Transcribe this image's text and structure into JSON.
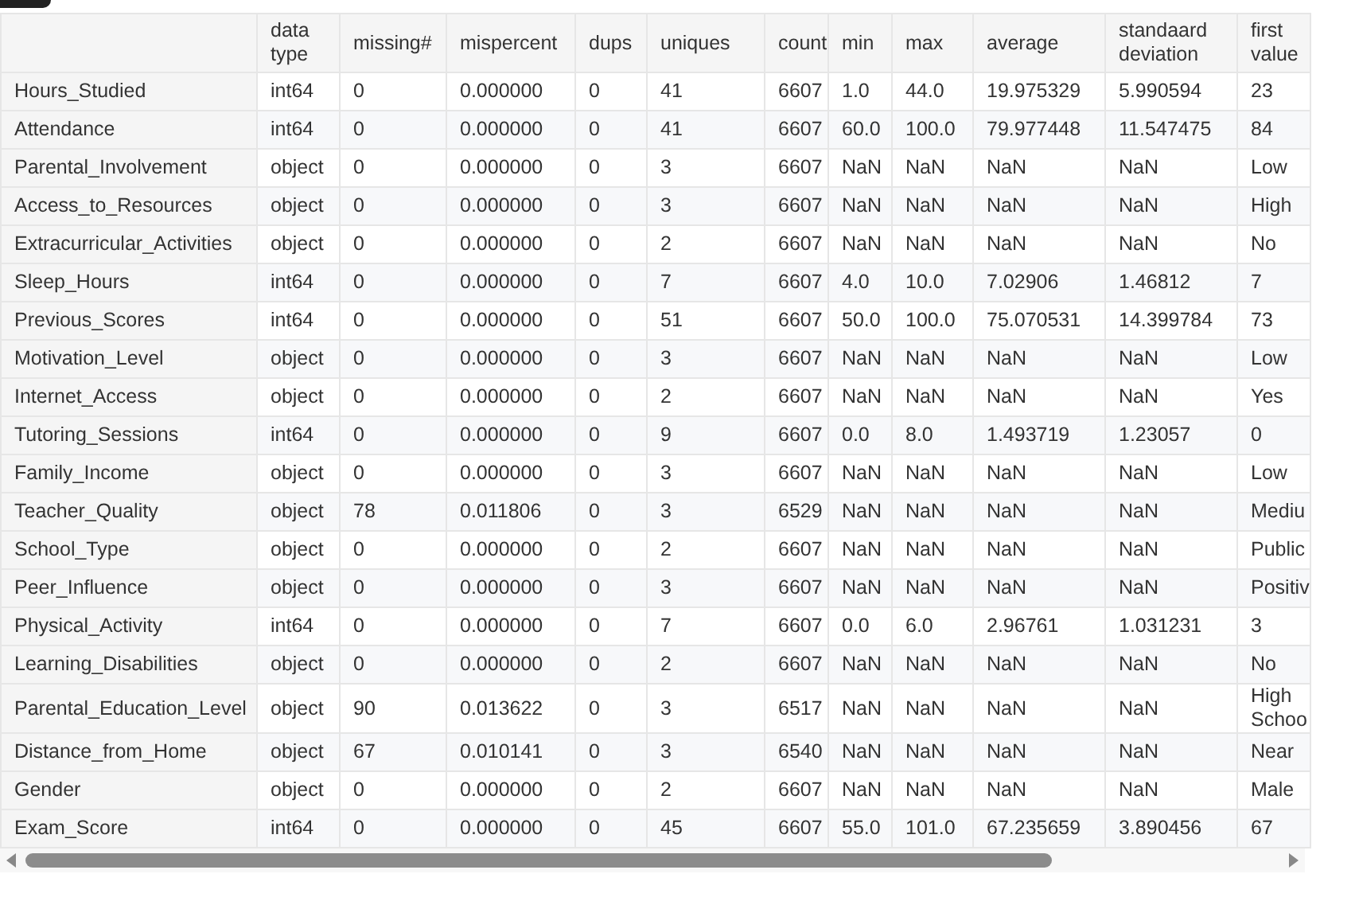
{
  "table": {
    "columns": [
      "data type",
      "missing#",
      "mispercent",
      "dups",
      "uniques",
      "count",
      "min",
      "max",
      "average",
      "standaard deviation",
      "first value"
    ],
    "rows": [
      {
        "name": "Hours_Studied",
        "cells": [
          "int64",
          "0",
          "0.000000",
          "0",
          "41",
          "6607",
          "1.0",
          "44.0",
          "19.975329",
          "5.990594",
          "23"
        ]
      },
      {
        "name": "Attendance",
        "cells": [
          "int64",
          "0",
          "0.000000",
          "0",
          "41",
          "6607",
          "60.0",
          "100.0",
          "79.977448",
          "11.547475",
          "84"
        ]
      },
      {
        "name": "Parental_Involvement",
        "cells": [
          "object",
          "0",
          "0.000000",
          "0",
          "3",
          "6607",
          "NaN",
          "NaN",
          "NaN",
          "NaN",
          "Low"
        ]
      },
      {
        "name": "Access_to_Resources",
        "cells": [
          "object",
          "0",
          "0.000000",
          "0",
          "3",
          "6607",
          "NaN",
          "NaN",
          "NaN",
          "NaN",
          "High"
        ]
      },
      {
        "name": "Extracurricular_Activities",
        "cells": [
          "object",
          "0",
          "0.000000",
          "0",
          "2",
          "6607",
          "NaN",
          "NaN",
          "NaN",
          "NaN",
          "No"
        ]
      },
      {
        "name": "Sleep_Hours",
        "cells": [
          "int64",
          "0",
          "0.000000",
          "0",
          "7",
          "6607",
          "4.0",
          "10.0",
          "7.02906",
          "1.46812",
          "7"
        ]
      },
      {
        "name": "Previous_Scores",
        "cells": [
          "int64",
          "0",
          "0.000000",
          "0",
          "51",
          "6607",
          "50.0",
          "100.0",
          "75.070531",
          "14.399784",
          "73"
        ]
      },
      {
        "name": "Motivation_Level",
        "cells": [
          "object",
          "0",
          "0.000000",
          "0",
          "3",
          "6607",
          "NaN",
          "NaN",
          "NaN",
          "NaN",
          "Low"
        ]
      },
      {
        "name": "Internet_Access",
        "cells": [
          "object",
          "0",
          "0.000000",
          "0",
          "2",
          "6607",
          "NaN",
          "NaN",
          "NaN",
          "NaN",
          "Yes"
        ]
      },
      {
        "name": "Tutoring_Sessions",
        "cells": [
          "int64",
          "0",
          "0.000000",
          "0",
          "9",
          "6607",
          "0.0",
          "8.0",
          "1.493719",
          "1.23057",
          "0"
        ]
      },
      {
        "name": "Family_Income",
        "cells": [
          "object",
          "0",
          "0.000000",
          "0",
          "3",
          "6607",
          "NaN",
          "NaN",
          "NaN",
          "NaN",
          "Low"
        ]
      },
      {
        "name": "Teacher_Quality",
        "cells": [
          "object",
          "78",
          "0.011806",
          "0",
          "3",
          "6529",
          "NaN",
          "NaN",
          "NaN",
          "NaN",
          "Mediu"
        ]
      },
      {
        "name": "School_Type",
        "cells": [
          "object",
          "0",
          "0.000000",
          "0",
          "2",
          "6607",
          "NaN",
          "NaN",
          "NaN",
          "NaN",
          "Public"
        ]
      },
      {
        "name": "Peer_Influence",
        "cells": [
          "object",
          "0",
          "0.000000",
          "0",
          "3",
          "6607",
          "NaN",
          "NaN",
          "NaN",
          "NaN",
          "Positiv"
        ]
      },
      {
        "name": "Physical_Activity",
        "cells": [
          "int64",
          "0",
          "0.000000",
          "0",
          "7",
          "6607",
          "0.0",
          "6.0",
          "2.96761",
          "1.031231",
          "3"
        ]
      },
      {
        "name": "Learning_Disabilities",
        "cells": [
          "object",
          "0",
          "0.000000",
          "0",
          "2",
          "6607",
          "NaN",
          "NaN",
          "NaN",
          "NaN",
          "No"
        ]
      },
      {
        "name": "Parental_Education_Level",
        "cells": [
          "object",
          "90",
          "0.013622",
          "0",
          "3",
          "6517",
          "NaN",
          "NaN",
          "NaN",
          "NaN",
          "High Schoo"
        ]
      },
      {
        "name": "Distance_from_Home",
        "cells": [
          "object",
          "67",
          "0.010141",
          "0",
          "3",
          "6540",
          "NaN",
          "NaN",
          "NaN",
          "NaN",
          "Near"
        ]
      },
      {
        "name": "Gender",
        "cells": [
          "object",
          "0",
          "0.000000",
          "0",
          "2",
          "6607",
          "NaN",
          "NaN",
          "NaN",
          "NaN",
          "Male"
        ]
      },
      {
        "name": "Exam_Score",
        "cells": [
          "int64",
          "0",
          "0.000000",
          "0",
          "45",
          "6607",
          "55.0",
          "101.0",
          "67.235659",
          "3.890456",
          "67"
        ]
      }
    ]
  }
}
